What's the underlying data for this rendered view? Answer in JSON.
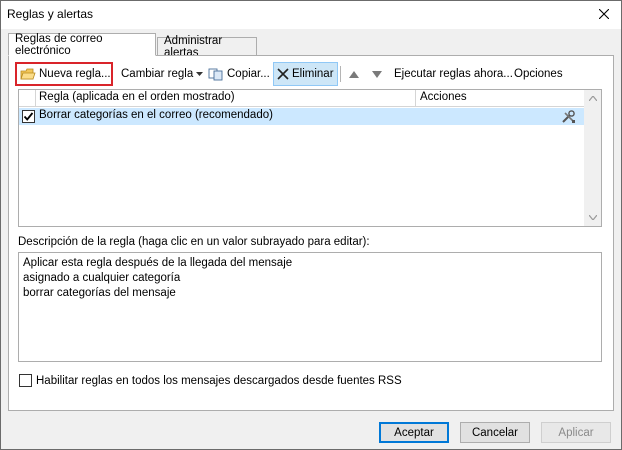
{
  "window": {
    "title": "Reglas y alertas"
  },
  "tabs": [
    {
      "label": "Reglas de correo electrónico"
    },
    {
      "label": "Administrar alertas"
    }
  ],
  "toolbar": {
    "new_rule": "Nueva regla...",
    "change_rule": "Cambiar regla",
    "copy": "Copiar...",
    "delete": "Eliminar",
    "run_rules": "Ejecutar reglas ahora...",
    "options": "Opciones"
  },
  "rules_list": {
    "columns": [
      "Regla (aplicada en el orden mostrado)",
      "Acciones"
    ],
    "rows": [
      {
        "label": "Borrar categorías en el correo (recomendado)",
        "checked": true
      }
    ]
  },
  "description": {
    "label": "Descripción de la regla (haga clic en un valor subrayado para editar):",
    "lines": [
      "Aplicar esta regla después de la llegada del mensaje",
      "asignado a cualquier categoría",
      "borrar categorías del mensaje"
    ]
  },
  "rss": {
    "label": "Habilitar reglas en todos los mensajes descargados desde fuentes RSS",
    "checked": false
  },
  "buttons": {
    "ok": "Aceptar",
    "cancel": "Cancelar",
    "apply": "Aplicar"
  },
  "colors": {
    "accent": "#0078d7",
    "selection": "#cce8ff",
    "highlight_border": "#d9242a"
  }
}
